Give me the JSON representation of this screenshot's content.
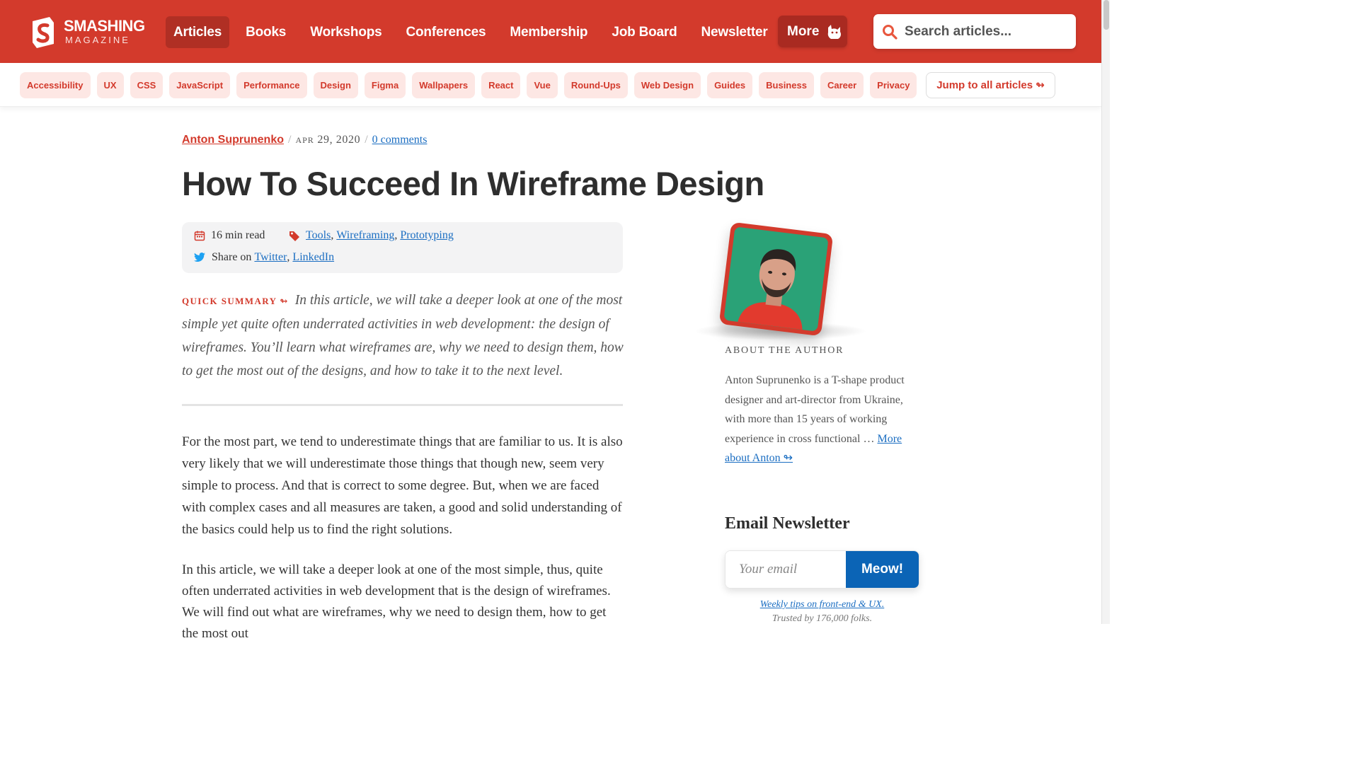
{
  "brand": {
    "name": "SMASHING",
    "sub": "MAGAZINE",
    "primary_color": "#d33a2c",
    "link_color": "#1b6ec2"
  },
  "nav": {
    "items": [
      {
        "label": "Articles",
        "active": true
      },
      {
        "label": "Books"
      },
      {
        "label": "Workshops"
      },
      {
        "label": "Conferences"
      },
      {
        "label": "Membership"
      },
      {
        "label": "Job Board"
      },
      {
        "label": "Newsletter"
      }
    ],
    "more_label": "More",
    "more_icon": "cat-icon"
  },
  "search": {
    "placeholder": "Search articles..."
  },
  "categories": [
    "Accessibility",
    "UX",
    "CSS",
    "JavaScript",
    "Performance",
    "Design",
    "Figma",
    "Wallpapers",
    "React",
    "Vue",
    "Round-Ups",
    "Web Design",
    "Guides",
    "Business",
    "Career",
    "Privacy"
  ],
  "jump_label": "Jump to all articles ↬",
  "article": {
    "author": "Anton Suprunenko",
    "date_month": "APR",
    "date_rest": "29, 2020",
    "comments": "0 comments",
    "title": "How To Succeed In Wireframe Design",
    "read_time": "16 min read",
    "tags": [
      "Tools",
      "Wireframing",
      "Prototyping"
    ],
    "share_label": "Share on",
    "share_links": [
      "Twitter",
      "LinkedIn"
    ],
    "summary_label": "QUICK SUMMARY ↬",
    "summary": "In this article, we will take a deeper look at one of the most simple yet quite often underrated activities in web development: the design of wireframes. You’ll learn what wireframes are, why we need to design them, how to get the most out of the designs, and how to take it to the next level.",
    "paragraphs": [
      "For the most part, we tend to underestimate things that are familiar to us. It is also very likely that we will underestimate those things that though new, seem very simple to process. And that is correct to some degree. But, when we are faced with complex cases and all measures are taken, a good and solid understanding of the basics could help us to find the right solutions.",
      "In this article, we will take a deeper look at one of the most simple, thus, quite often underrated activities in web development that is the design of wireframes. We will find out what are wireframes, why we need to design them, how to get the most out"
    ]
  },
  "sidebar": {
    "about_label": "ABOUT THE AUTHOR",
    "about_text": "Anton Suprunenko is a T-shape product designer and art-director from Ukraine, with more than 15 years of working experience in cross functional …",
    "about_more": "More about Anton ↬",
    "newsletter_title": "Email Newsletter",
    "email_placeholder": "Your email",
    "submit_label": "Meow!",
    "tip": "Weekly tips on front-end & UX.",
    "trust": "Trusted by 176,000 folks."
  }
}
